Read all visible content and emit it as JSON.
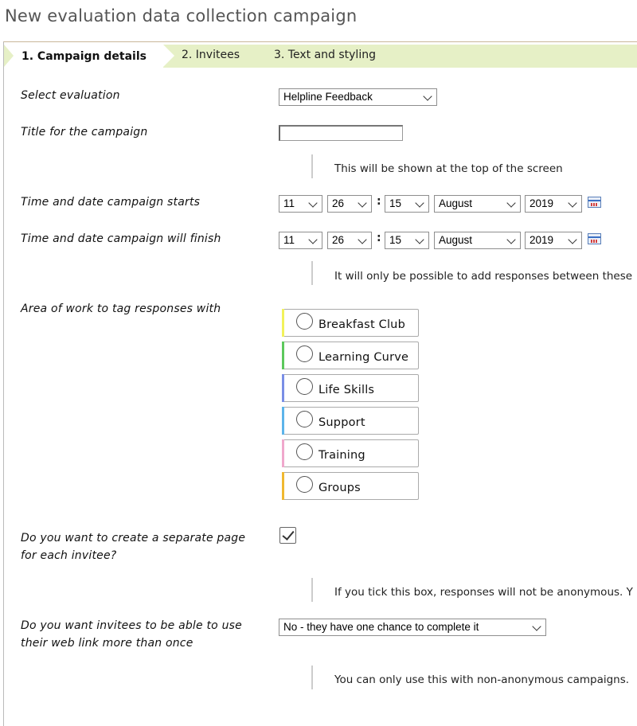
{
  "page_title": "New evaluation data collection campaign",
  "tabs": [
    {
      "label": "1. Campaign details",
      "active": true
    },
    {
      "label": "2. Invitees",
      "active": false
    },
    {
      "label": "3. Text and styling",
      "active": false
    }
  ],
  "form": {
    "select_evaluation": {
      "label": "Select evaluation",
      "value": "Helpline Feedback"
    },
    "campaign_title": {
      "label": "Title for the campaign",
      "value": "",
      "help": "This will be shown at the top of the screen"
    },
    "start": {
      "label": "Time and date campaign starts",
      "hour": "11",
      "day": "26",
      "minute": "15",
      "month": "August",
      "year": "2019"
    },
    "finish": {
      "label": "Time and date campaign will finish",
      "hour": "11",
      "day": "26",
      "minute": "15",
      "month": "August",
      "year": "2019",
      "help": "It will only be possible to add responses between these"
    },
    "time_separator": ":",
    "area_of_work": {
      "label": "Area of work to tag responses with",
      "options": [
        {
          "label": "Breakfast Club",
          "color": "#f2f25a"
        },
        {
          "label": "Learning Curve",
          "color": "#5cc85c"
        },
        {
          "label": "Life Skills",
          "color": "#7a8ee6"
        },
        {
          "label": "Support",
          "color": "#5cb4ea"
        },
        {
          "label": "Training",
          "color": "#f0a8cc"
        },
        {
          "label": "Groups",
          "color": "#f0b830"
        }
      ]
    },
    "separate_page": {
      "label_line1": "Do you want to create a separate page",
      "label_line2": "for each invitee?",
      "checked": true,
      "help": "If you tick this box, responses will not be anonymous. Y"
    },
    "reuse_link": {
      "label_line1": "Do you want invitees to be able to use",
      "label_line2": "their web link more than once",
      "value": "No - they have one chance to complete it",
      "help": "You can only use this with non-anonymous campaigns."
    }
  }
}
